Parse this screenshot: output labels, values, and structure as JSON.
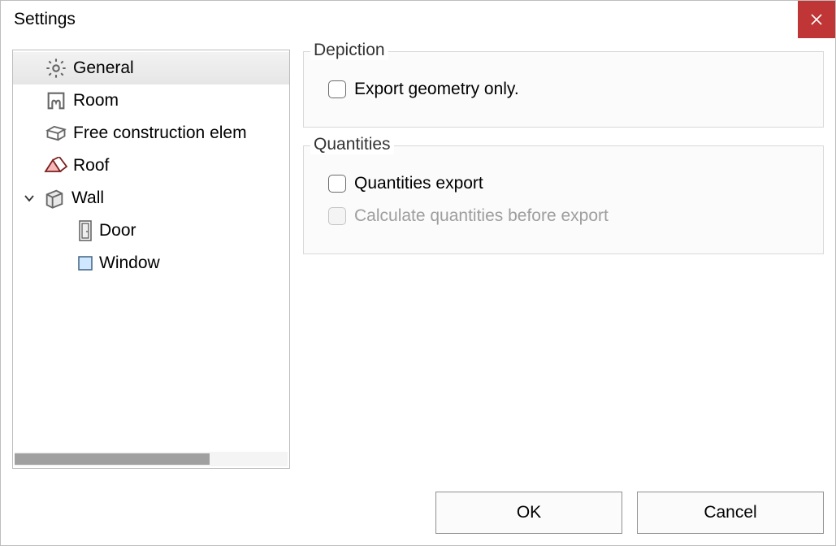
{
  "window": {
    "title": "Settings"
  },
  "tree": {
    "items": [
      {
        "label": "General",
        "selected": true
      },
      {
        "label": "Room"
      },
      {
        "label": "Free construction elem"
      },
      {
        "label": "Roof"
      },
      {
        "label": "Wall",
        "expandable": true
      },
      {
        "label": "Door",
        "child": true
      },
      {
        "label": "Window",
        "child": true
      }
    ]
  },
  "groups": {
    "depiction": {
      "title": "Depiction",
      "export_geometry_only": "Export geometry only."
    },
    "quantities": {
      "title": "Quantities",
      "quantities_export": "Quantities export",
      "calc_before_export": "Calculate quantities before export"
    }
  },
  "buttons": {
    "ok": "OK",
    "cancel": "Cancel"
  }
}
